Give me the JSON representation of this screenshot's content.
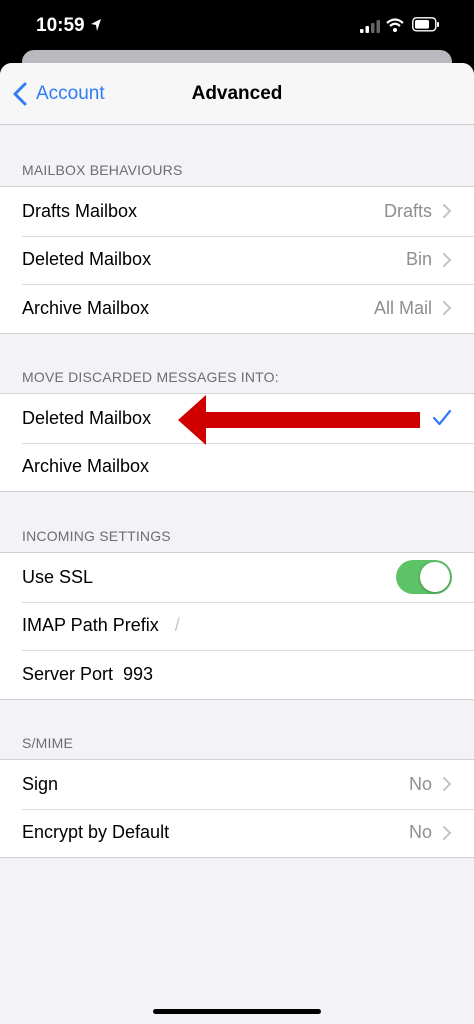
{
  "status_bar": {
    "time": "10:59"
  },
  "nav": {
    "back_label": "Account",
    "title": "Advanced"
  },
  "sections": {
    "mailbox_behaviours": {
      "header": "MAILBOX BEHAVIOURS",
      "rows": [
        {
          "label": "Drafts Mailbox",
          "value": "Drafts"
        },
        {
          "label": "Deleted Mailbox",
          "value": "Bin"
        },
        {
          "label": "Archive Mailbox",
          "value": "All Mail"
        }
      ]
    },
    "move_discarded": {
      "header": "MOVE DISCARDED MESSAGES INTO:",
      "rows": [
        {
          "label": "Deleted Mailbox",
          "selected": true
        },
        {
          "label": "Archive Mailbox",
          "selected": false
        }
      ]
    },
    "incoming": {
      "header": "INCOMING SETTINGS",
      "use_ssl": {
        "label": "Use SSL",
        "on": true
      },
      "imap_path": {
        "label": "IMAP Path Prefix",
        "value": "/"
      },
      "server_port": {
        "label": "Server Port",
        "value": "993"
      }
    },
    "smime": {
      "header": "S/MIME",
      "rows": [
        {
          "label": "Sign",
          "value": "No"
        },
        {
          "label": "Encrypt by Default",
          "value": "No"
        }
      ]
    }
  },
  "colors": {
    "accent": "#2f7cf6",
    "toggle_on": "#5cc466",
    "annotation_arrow": "#d00000"
  }
}
